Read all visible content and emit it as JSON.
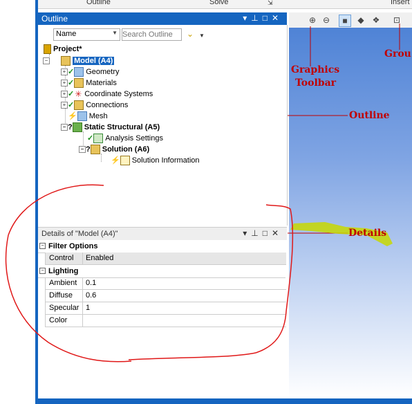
{
  "ribbon": {
    "tabs": [
      "Outline",
      "Solve",
      "Insert"
    ]
  },
  "outline": {
    "title": "Outline",
    "name_select": "Name",
    "search_placeholder": "Search Outline",
    "tree": {
      "project": "Project*",
      "model": "Model (A4)",
      "geometry": "Geometry",
      "materials": "Materials",
      "coordinate_systems": "Coordinate Systems",
      "connections": "Connections",
      "mesh": "Mesh",
      "static_structural": "Static Structural (A5)",
      "analysis_settings": "Analysis Settings",
      "solution": "Solution (A6)",
      "solution_information": "Solution Information"
    }
  },
  "details": {
    "title": "Details of \"Model (A4)\"",
    "groups": [
      {
        "label": "Filter Options",
        "rows": [
          {
            "key": "Control",
            "value": "Enabled"
          }
        ]
      },
      {
        "label": "Lighting",
        "rows": [
          {
            "key": "Ambient",
            "value": "0.1"
          },
          {
            "key": "Diffuse",
            "value": "0.6"
          },
          {
            "key": "Specular",
            "value": "1"
          },
          {
            "key": "Color",
            "value": ""
          }
        ]
      }
    ]
  },
  "annotations": {
    "graphics_toolbar_line1": "Graphics",
    "graphics_toolbar_line2": "Toolbar",
    "outline": "Outline",
    "details": "Details",
    "group": "Grou"
  },
  "colors": {
    "accent": "#1565c0",
    "annotation": "#c00000",
    "highlight": "#c8d800"
  }
}
